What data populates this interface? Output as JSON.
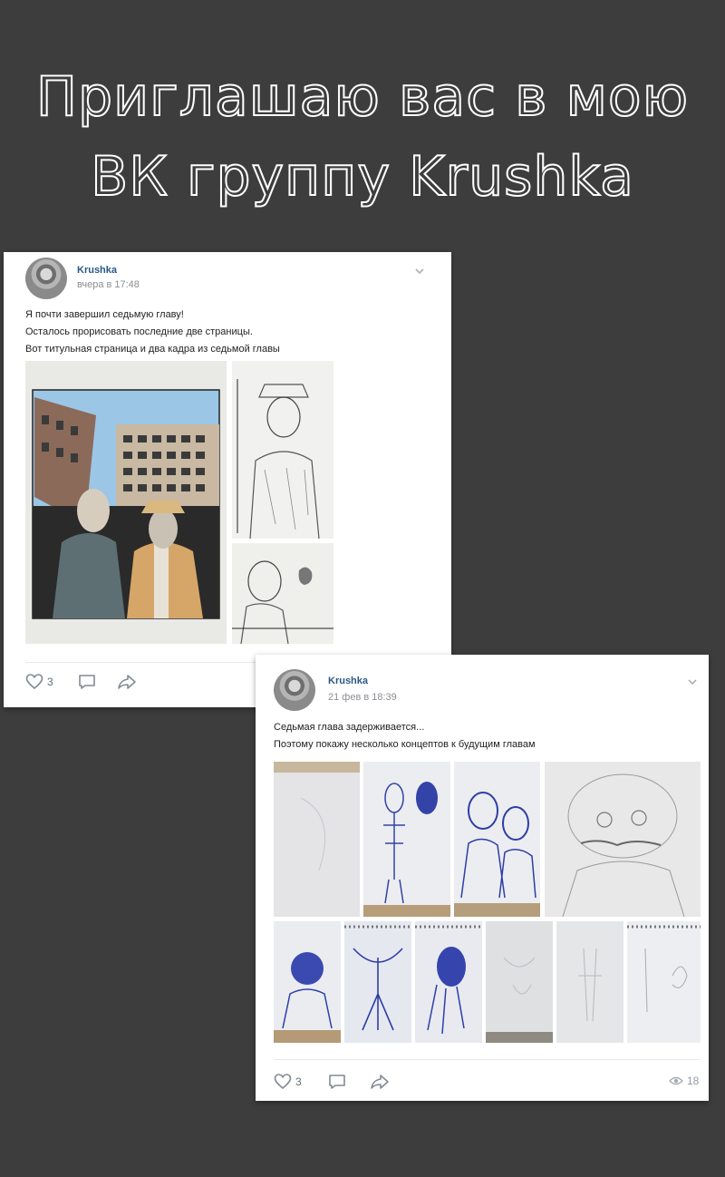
{
  "headline": {
    "line1": "Приглашаю вас в мою",
    "line2": "ВК группу Krushka"
  },
  "posts": [
    {
      "author": "Krushka",
      "time": "вчера в 17:48",
      "text": [
        "Я почти завершил седьмую главу!",
        "Осталось прорисовать последние две страницы.",
        "Вот титульная страница и два кадра из седьмой главы"
      ],
      "likes": "3"
    },
    {
      "author": "Krushka",
      "time": "21 фев в 18:39",
      "text": [
        "Седьмая глава задерживается...",
        "Поэтому покажу несколько концептов к будущим главам"
      ],
      "likes": "3",
      "views": "18"
    }
  ],
  "colors": {
    "background": "#3d3d3d",
    "link": "#2a5885",
    "muted": "#828a94"
  }
}
